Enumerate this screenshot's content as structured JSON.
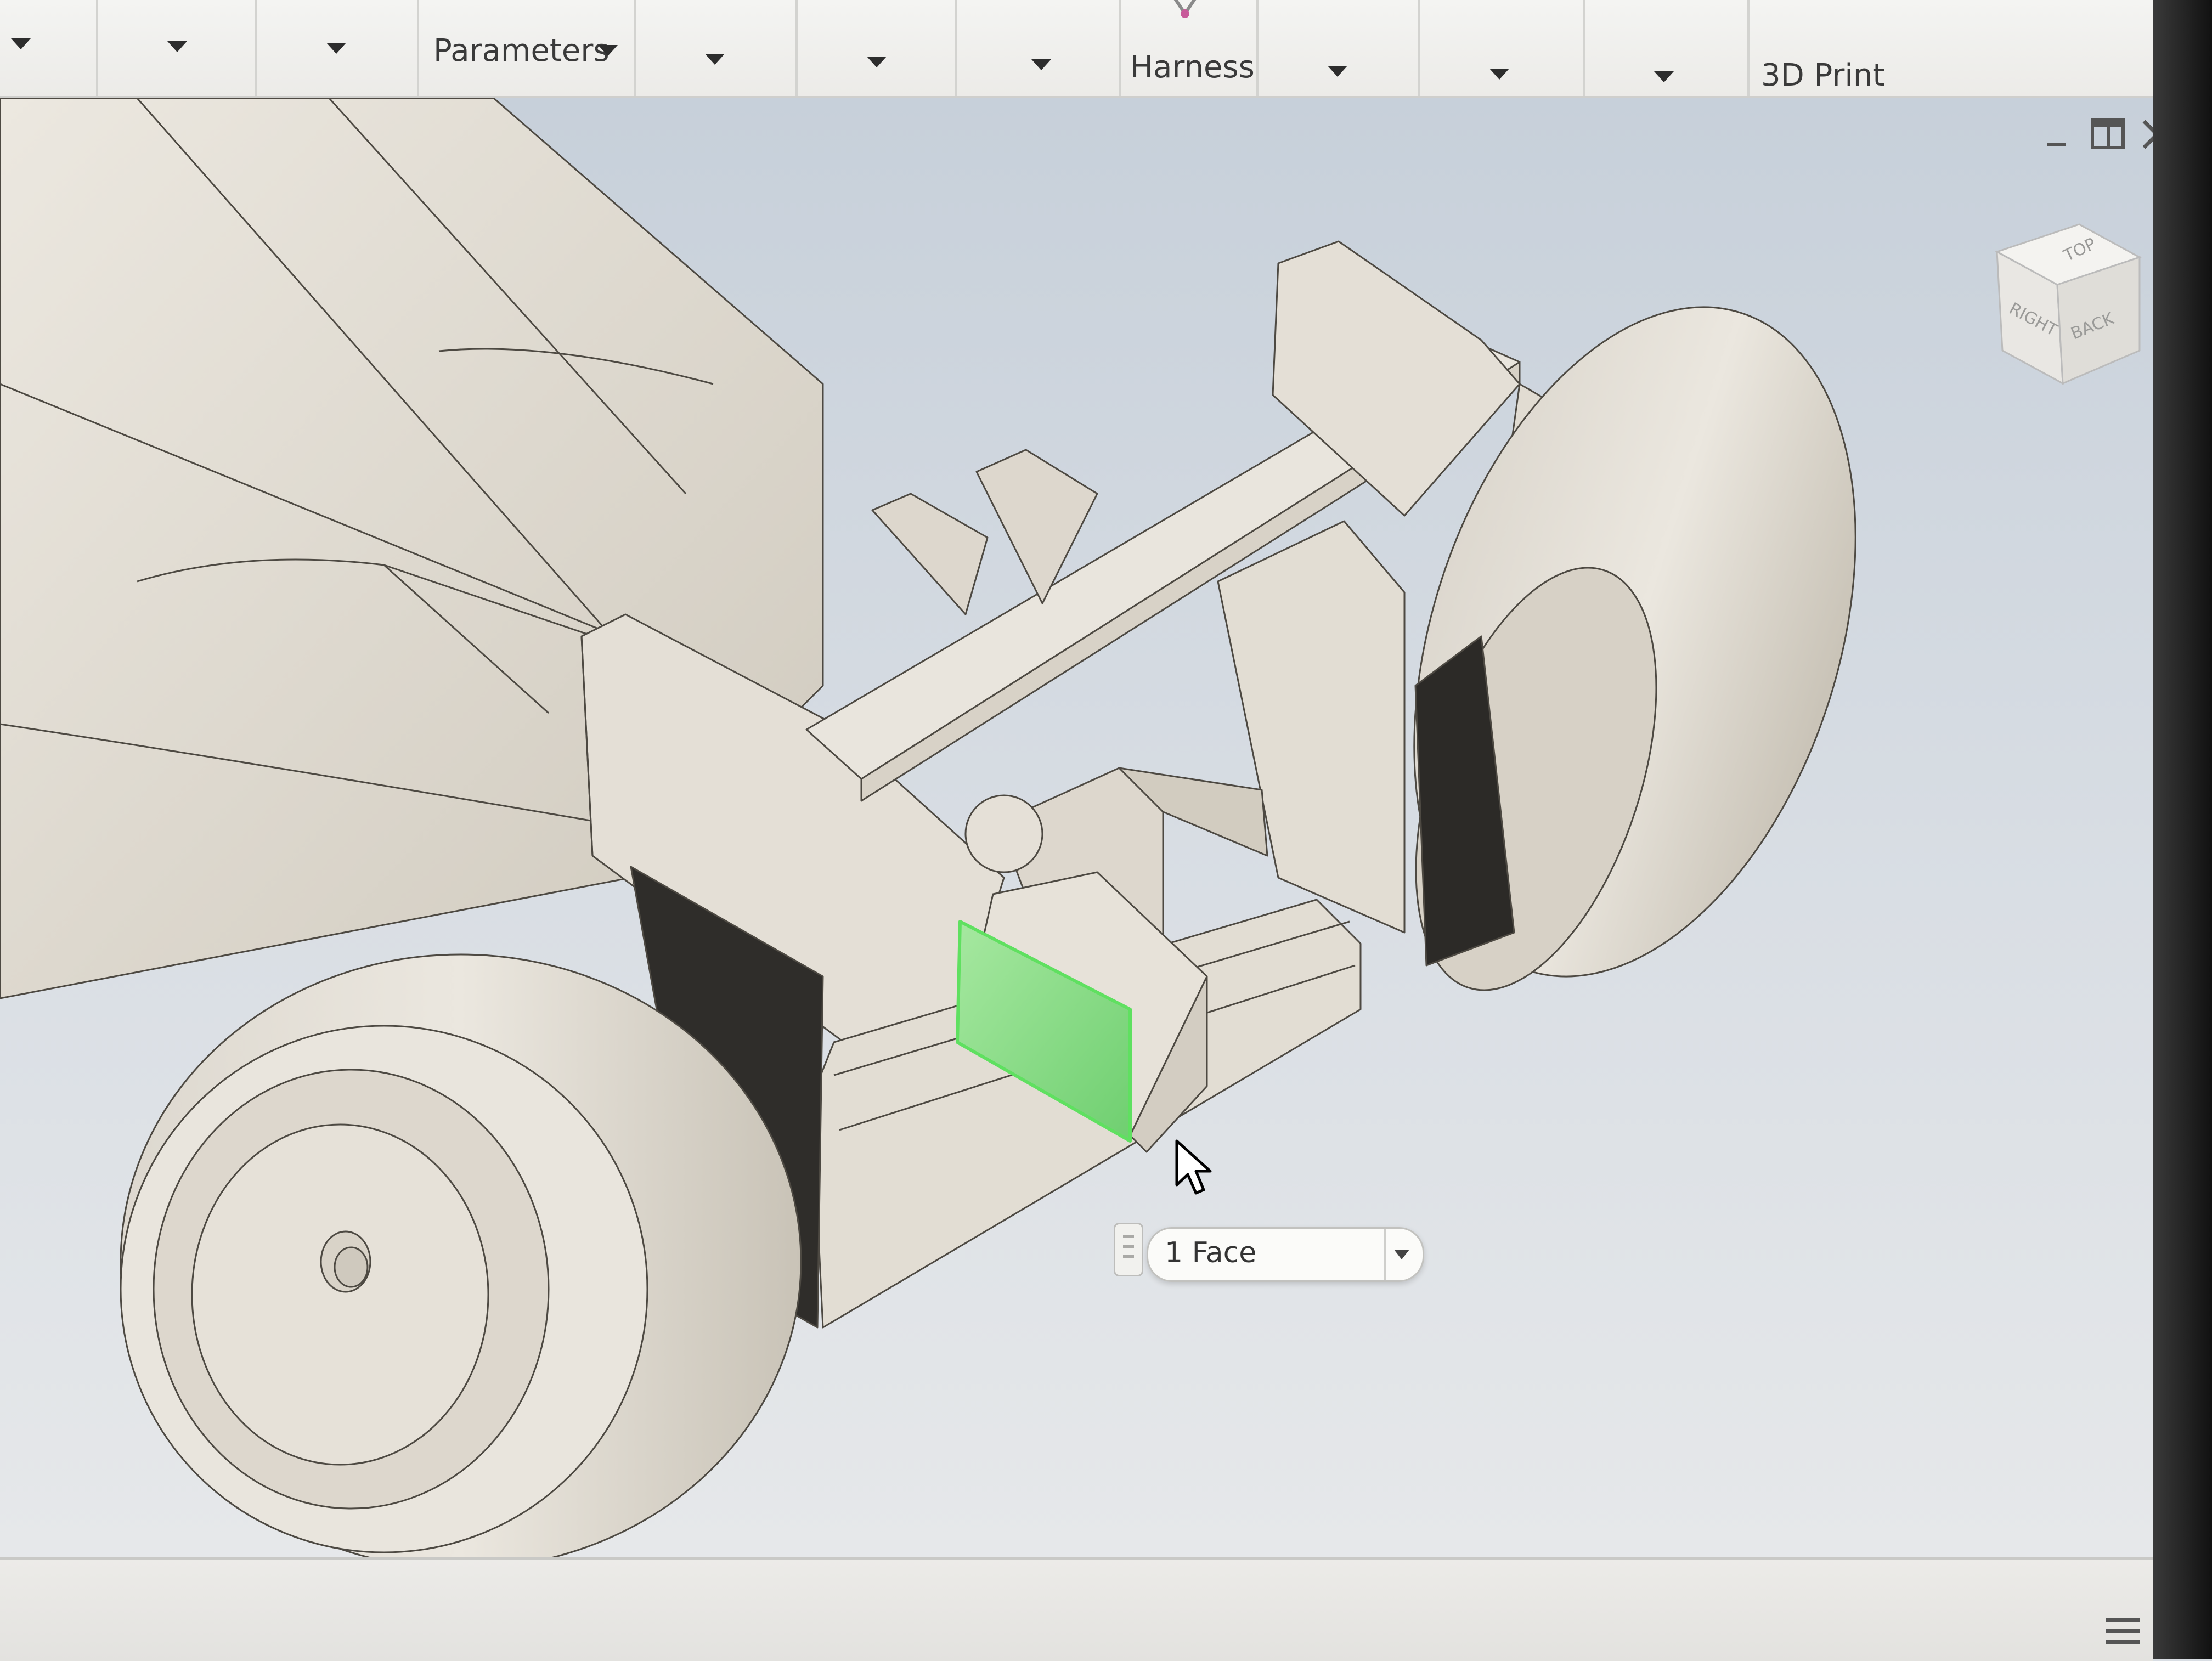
{
  "ribbon": {
    "panels": [
      {
        "id": "p0",
        "label": ""
      },
      {
        "id": "p1",
        "label": ""
      },
      {
        "id": "p2",
        "label": ""
      },
      {
        "id": "p3",
        "label": "Parameters"
      },
      {
        "id": "p4",
        "label": ""
      },
      {
        "id": "p5",
        "label": ""
      },
      {
        "id": "p6",
        "label": ""
      },
      {
        "id": "p7",
        "label": "Harness"
      },
      {
        "id": "p8",
        "label": ""
      },
      {
        "id": "p9",
        "label": ""
      },
      {
        "id": "p10",
        "label": ""
      },
      {
        "id": "p11",
        "label": "3D Print"
      }
    ]
  },
  "window_controls": {
    "icons": [
      "minimize-icon",
      "restore-layout-icon",
      "close-icon"
    ]
  },
  "viewcube": {
    "faces": {
      "top": "TOP",
      "right": "RIGHT",
      "back": "BACK"
    }
  },
  "selection": {
    "value": "1 Face"
  },
  "colors": {
    "model_fill": "#e7e2d9",
    "model_edge": "#4a4640",
    "highlight": "#7fe07a",
    "viewport_top": "#c7d0da",
    "viewport_bottom": "#e6e8ea"
  },
  "icons": {
    "status_menu": "hamburger-menu-icon",
    "cursor": "mouse-pointer-icon"
  }
}
